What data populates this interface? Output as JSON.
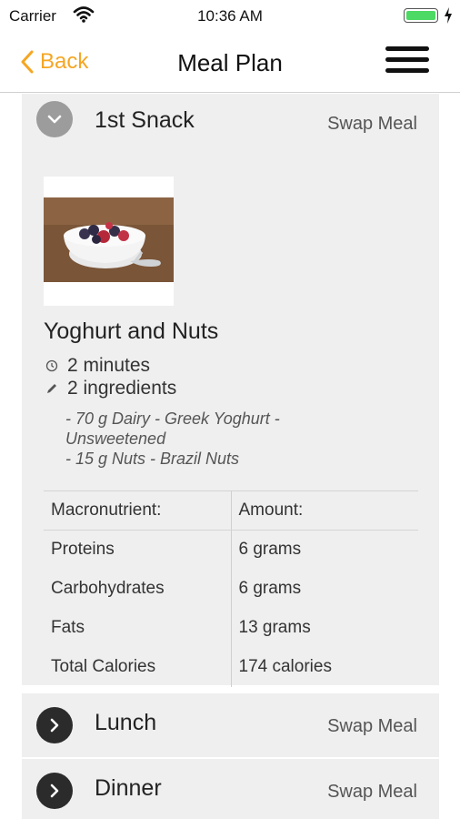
{
  "status_bar": {
    "carrier": "Carrier",
    "time": "10:36 AM",
    "battery_level": 1.0
  },
  "nav": {
    "back_label": "Back",
    "title": "Meal Plan",
    "accent": "#f5a623"
  },
  "meals": [
    {
      "name": "1st Snack",
      "swap_label": "Swap Meal",
      "expanded": true,
      "recipe": {
        "title": "Yoghurt and Nuts",
        "time": "2 minutes",
        "ingredients_count": "2 ingredients",
        "ingredients": [
          "- 70 g Dairy - Greek Yoghurt - Unsweetened",
          "- 15 g Nuts - Brazil Nuts"
        ],
        "macro_headers": [
          "Macronutrient:",
          "Amount:"
        ],
        "macros": [
          {
            "name": "Proteins",
            "amount": "6 grams"
          },
          {
            "name": "Carbohydrates",
            "amount": "6 grams"
          },
          {
            "name": "Fats",
            "amount": "13 grams"
          },
          {
            "name": "Total Calories",
            "amount": "174 calories"
          }
        ]
      }
    },
    {
      "name": "Lunch",
      "swap_label": "Swap Meal",
      "expanded": false
    },
    {
      "name": "Dinner",
      "swap_label": "Swap Meal",
      "expanded": false
    }
  ],
  "icons": {
    "back": "chevron-left-icon",
    "menu": "hamburger-menu-icon",
    "collapse": "chevron-down-icon",
    "expand": "chevron-right-icon",
    "time": "clock-icon",
    "ingredients": "pencil-icon"
  }
}
